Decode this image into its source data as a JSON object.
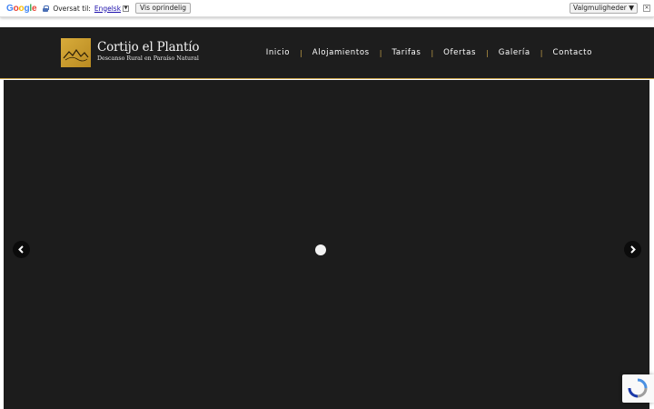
{
  "translate_bar": {
    "logo_text": "Google",
    "logo_colors": [
      "#4285F4",
      "#EA4335",
      "#FBBC05",
      "#4285F4",
      "#34A853",
      "#EA4335"
    ],
    "translated_to_label": "Oversat til:",
    "language": "Engelsk",
    "show_original_label": "Vis oprindelig",
    "options_label": "Valgmuligheder ▼",
    "close_icon": "×"
  },
  "header": {
    "site_title": "Cortijo el Plantío",
    "site_subtitle": "Descanso Rural en Paraíso Natural",
    "accent_color": "#c7a34a",
    "nav": [
      {
        "label": "Inicio"
      },
      {
        "label": "Alojamientos"
      },
      {
        "label": "Tarifas"
      },
      {
        "label": "Ofertas"
      },
      {
        "label": "Galería"
      },
      {
        "label": "Contacto"
      }
    ],
    "separator": "|"
  },
  "slider": {
    "prev_icon": "‹",
    "next_icon": "›",
    "state": "loading"
  }
}
